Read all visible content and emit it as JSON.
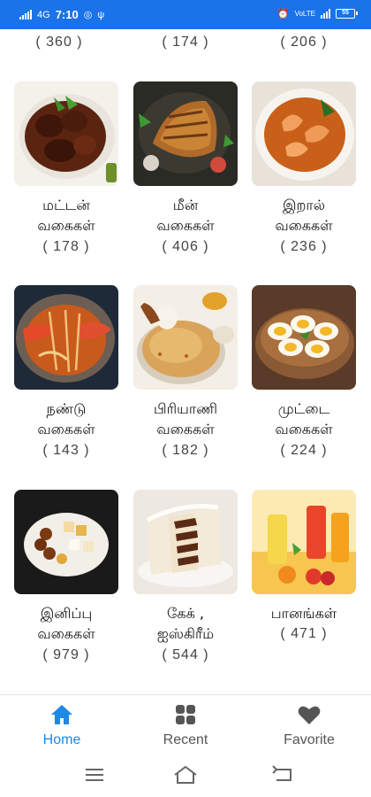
{
  "status_bar": {
    "time": "7:10",
    "network": "4G",
    "battery": "55",
    "icons": [
      "signal-icon",
      "whatsapp-icon",
      "usb-icon",
      "alarm-icon",
      "volte-icon",
      "battery-icon"
    ]
  },
  "top_row_counts": [
    "( 360 )",
    "( 174 )",
    "( 206 )"
  ],
  "categories": [
    {
      "line1": "மட்டன்",
      "line2": "வகைகள்",
      "count": "( 178 )",
      "image": "mutton-curry-image"
    },
    {
      "line1": "மீன்",
      "line2": "வகைகள்",
      "count": "( 406 )",
      "image": "grilled-fish-image"
    },
    {
      "line1": "இறால்",
      "line2": "வகைகள்",
      "count": "( 236 )",
      "image": "prawn-curry-image"
    },
    {
      "line1": "நண்டு",
      "line2": "வகைகள்",
      "count": "( 143 )",
      "image": "crab-masala-image"
    },
    {
      "line1": "பிரியாணி",
      "line2": "வகைகள்",
      "count": "( 182 )",
      "image": "chicken-biryani-image"
    },
    {
      "line1": "முட்டை",
      "line2": "வகைகள்",
      "count": "( 224 )",
      "image": "boiled-eggs-image"
    },
    {
      "line1": "இனிப்பு",
      "line2": "வகைகள்",
      "count": "( 979 )",
      "image": "indian-sweets-image"
    },
    {
      "line1": "கேக் ,",
      "line2": "ஐஸ்கிரீம்",
      "count": "( 544 )",
      "image": "layer-cake-image"
    },
    {
      "line1": "பானங்கள்",
      "line2": "",
      "count": "( 471 )",
      "image": "fruit-juices-image"
    }
  ],
  "bottom_nav": {
    "items": [
      {
        "label": "Home",
        "icon": "home-icon",
        "active": true
      },
      {
        "label": "Recent",
        "icon": "grid-icon",
        "active": false
      },
      {
        "label": "Favorite",
        "icon": "heart-icon",
        "active": false
      }
    ]
  },
  "colors": {
    "status_bar": "#1a73e8",
    "active_nav": "#1e88e5",
    "inactive_nav": "#555555"
  }
}
